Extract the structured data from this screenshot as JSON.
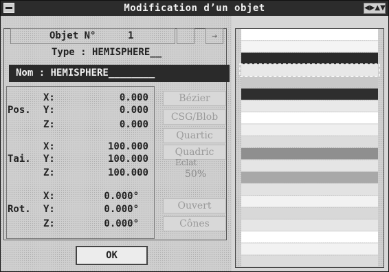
{
  "window": {
    "title": "Modification d’un objet",
    "resize_icon": "◀▶▲▼"
  },
  "object": {
    "label": "Objet N°",
    "number": "1",
    "nav_next": "→"
  },
  "type_line": "Type : HEMISPHERE__",
  "name_field": "Nom : HEMISPHERE________",
  "position": {
    "label": "Pos.",
    "x": "0.000",
    "y": "0.000",
    "z": "0.000"
  },
  "size": {
    "label": "Tai.",
    "x": "100.000",
    "y": "100.000",
    "z": "100.000"
  },
  "rotation": {
    "label": "Rot.",
    "x": "0.000°",
    "y": "0.000°",
    "z": "0.000°"
  },
  "axes": {
    "x": "X:",
    "y": "Y:",
    "z": "Z:"
  },
  "buttons": {
    "bezier": "Bézier",
    "csg": "CSG/Blob",
    "quartic": "Quartic",
    "quadric": "Quadric",
    "open": "Ouvert",
    "cones": "Cônes",
    "ok": "OK"
  },
  "extra": {
    "label": "Eclat",
    "value": "50%"
  },
  "colors": {
    "title_bg": "#2c2c2c",
    "field_bg": "#2a2a2a",
    "window_bg": "#d6d6d6"
  },
  "preview_stripes": [
    "#ffffff",
    "#f4f4f4",
    "#2a2a2a",
    "#e8e8e8",
    "#c8c8c8",
    "#2e2e2e",
    "#e9e9e9",
    "#ffffff",
    "#efefef",
    "#dcdcdc",
    "#8f8f8f",
    "#e5e5e5",
    "#a8a8a8",
    "#e2e2e2",
    "#f2f2f2",
    "#d8d8d8",
    "#e6e6e6",
    "#ffffff",
    "#f2f2f2",
    "#dcdcdc"
  ]
}
